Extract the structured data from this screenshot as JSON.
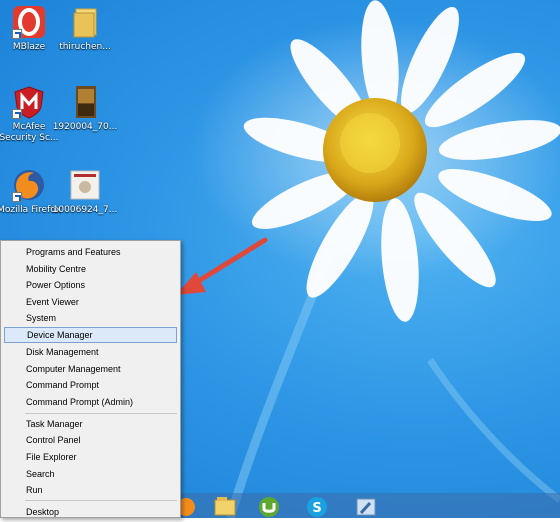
{
  "desktop": {
    "icons": [
      {
        "name": "mblaze",
        "label": "MBlaze"
      },
      {
        "name": "folder",
        "label": "thiruchen..."
      },
      {
        "name": "mcafee",
        "label": "McAfee Security Sc..."
      },
      {
        "name": "photo",
        "label": "1920004_70..."
      },
      {
        "name": "firefox",
        "label": "Mozilla Firefox"
      },
      {
        "name": "image",
        "label": "10006924_7..."
      }
    ]
  },
  "context_menu": {
    "items": [
      "Programs and Features",
      "Mobility Centre",
      "Power Options",
      "Event Viewer",
      "System",
      "Device Manager",
      "Disk Management",
      "Computer Management",
      "Command Prompt",
      "Command Prompt (Admin)",
      "Task Manager",
      "Control Panel",
      "File Explorer",
      "Search",
      "Run",
      "Desktop"
    ],
    "selected": "Device Manager"
  },
  "taskbar": {
    "icons": [
      "firefox-icon",
      "file-explorer-icon",
      "utorrent-icon",
      "skype-icon",
      "app-icon"
    ]
  },
  "annotation": {
    "type": "arrow",
    "color": "#e0493a",
    "points_to": "Device Manager"
  }
}
